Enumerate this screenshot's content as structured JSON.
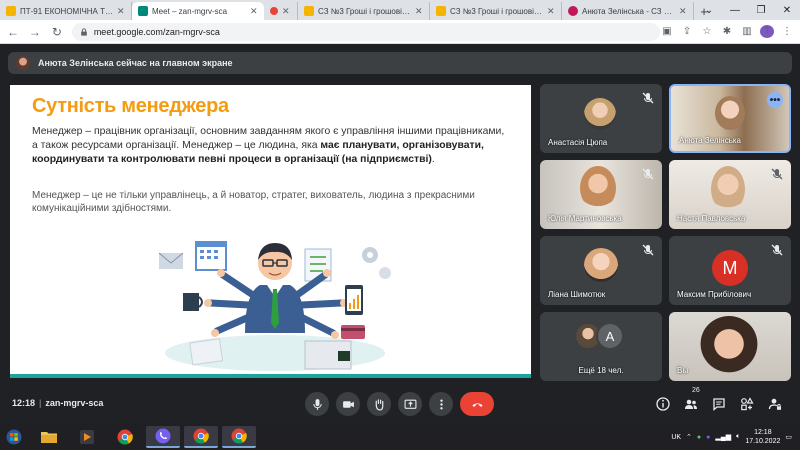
{
  "browser": {
    "tabs": [
      {
        "title": "ПТ-91 ЕКОНОМІЧНА ТЕОРІЯ",
        "fav_color": "#f4b400",
        "active": false
      },
      {
        "title": "Meet – zan-mgrv-sca",
        "fav_color": "#00897b",
        "active": true
      },
      {
        "title": "",
        "fav_color": "#ea4335",
        "active": false
      },
      {
        "title": "СЗ №3 Гроші і грошові систе",
        "fav_color": "#f4b400",
        "active": false
      },
      {
        "title": "СЗ №3 Гроші і грошові систе",
        "fav_color": "#f4b400",
        "active": false
      },
      {
        "title": "Анюта Зелінська - СЗ №3 Ро",
        "fav_color": "#c2185b",
        "active": false
      }
    ],
    "new_tab": "+",
    "url": "meet.google.com/zan-mgrv-sca",
    "profile_initial": "T"
  },
  "banner": {
    "text": "Анюта Зелінська сейчас на главном экране"
  },
  "slide": {
    "title": "Сутність менеджера",
    "p1_plain": "Менеджер – працівник організації, основним завданням якого є управління іншими працівниками, а також ресурсами організації. Менеджер – це людина, яка ",
    "p1_bold": "має планувати, організовувати, координувати та контролювати певні процеси в організації (на підприємстві)",
    "p1_end": ".",
    "p2": "Менеджер – це не тільки управлінець, а й новатор, стратег, вихователь, людина з прекрасними комунікаційними здібностями."
  },
  "participants": [
    {
      "name": "Анастасія Цюпа",
      "muted": true
    },
    {
      "name": "Анюта Зелінська",
      "muted": false,
      "more": "•••"
    },
    {
      "name": "Юлія Мартиновська",
      "muted": true
    },
    {
      "name": "Настя Павловська",
      "muted": true
    },
    {
      "name": "Ліана Шимотюк",
      "muted": true
    },
    {
      "name": "Максим Прибілович",
      "muted": true,
      "initial": "M",
      "color": "#d93025"
    },
    {
      "name": "Ещё 18 чел.",
      "initial": "A",
      "color": "#5f6368"
    },
    {
      "name": "Вы",
      "muted": false
    }
  ],
  "meeting": {
    "time": "12:18",
    "code": "zan-mgrv-sca",
    "people_count": "26"
  },
  "taskbar": {
    "lang": "UK",
    "time": "12:18",
    "date": "17.10.2022"
  }
}
